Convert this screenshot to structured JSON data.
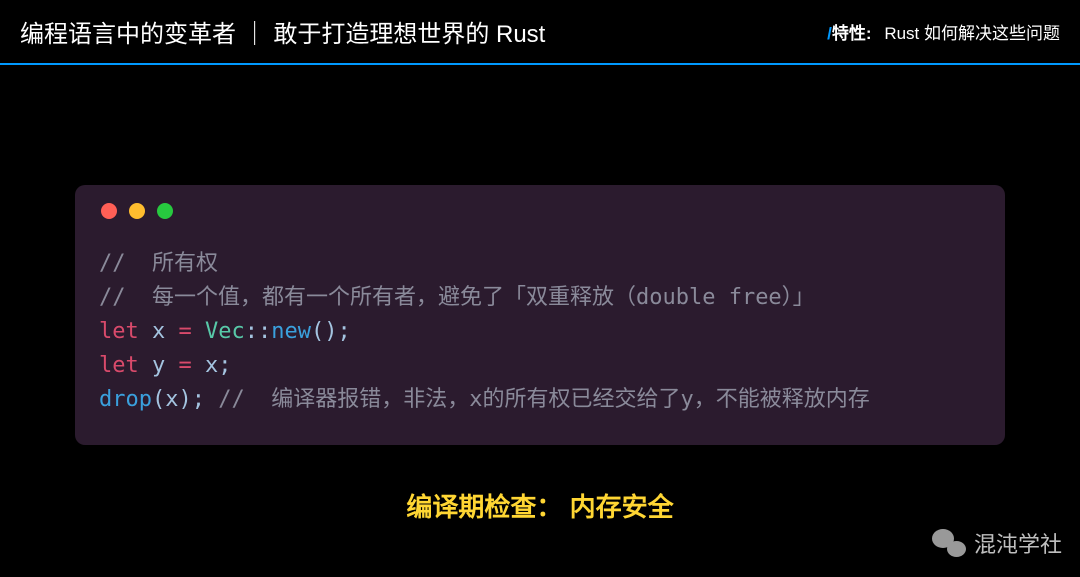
{
  "header": {
    "title_left": "编程语言中的变革者 ｜ 敢于打造理想世界的 Rust",
    "slash": "/",
    "feature_label": "特性:",
    "feature_desc": "Rust 如何解决这些问题"
  },
  "code": {
    "line1_comment": "//  所有权",
    "line2_comment": "//  每一个值，都有一个所有者，避免了「双重释放（double free）」",
    "line3": {
      "kw_let": "let",
      "var_x": "x",
      "eq": "=",
      "type_vec": "Vec",
      "dcolon": "::",
      "fn_new": "new",
      "parens": "();"
    },
    "line4": {
      "kw_let": "let",
      "var_y": "y",
      "eq": "=",
      "var_x": "x",
      "semi": ";"
    },
    "line5": {
      "fn_drop": "drop",
      "lparen": "(",
      "var_x": "x",
      "rparen_semi": ");",
      "comment": "//  编译器报错，非法，x的所有权已经交给了y，不能被释放内存"
    }
  },
  "caption": "编译期检查： 内存安全",
  "watermark": {
    "text": "混沌学社",
    "icon_name": "wechat-icon"
  }
}
